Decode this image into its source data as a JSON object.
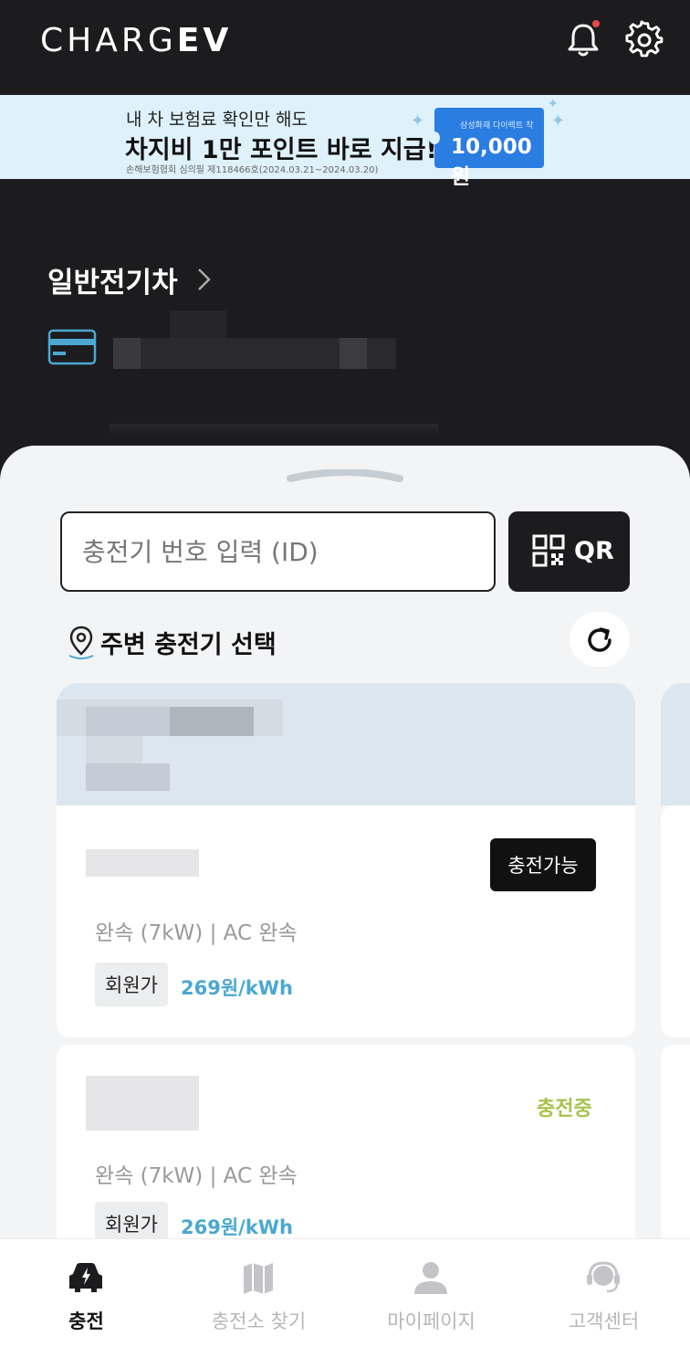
{
  "header": {
    "logo_light": "CHARG",
    "logo_bold": "EV",
    "notification_dot_color": "#e5484d"
  },
  "banner": {
    "line1": "내 차 보험료 확인만 해도",
    "line2": "차지비 1만 포인트 바로 지급!",
    "disclaimer": "손해보험협회 심의필 제118466호(2024.03.21~2024.03.20)",
    "coupon_brand": "삼성화재 다이렉트 착",
    "coupon_amount": "10,000원"
  },
  "vehicle": {
    "title": "일반전기차"
  },
  "search": {
    "placeholder": "충전기 번호 입력 (ID)",
    "qr_label": "QR"
  },
  "nearby": {
    "label": "주변 충전기 선택"
  },
  "chargers": [
    {
      "status": "충전가능",
      "type": "완속 (7kW) | AC 완속",
      "member_label": "회원가",
      "price": "269원/kWh"
    },
    {
      "status": "충전중",
      "type": "완속 (7kW) | AC 완속",
      "member_label": "회원가",
      "price": "269원/kWh"
    }
  ],
  "tabs": [
    {
      "label": "충전",
      "active": true
    },
    {
      "label": "충전소 찾기",
      "active": false
    },
    {
      "label": "마이페이지",
      "active": false
    },
    {
      "label": "고객센터",
      "active": false
    }
  ],
  "colors": {
    "accent_price": "#4aa8d1",
    "status_charging": "#a9c24a",
    "banner_bg": "#dff1fb",
    "coupon_bg": "#2a7de1"
  }
}
